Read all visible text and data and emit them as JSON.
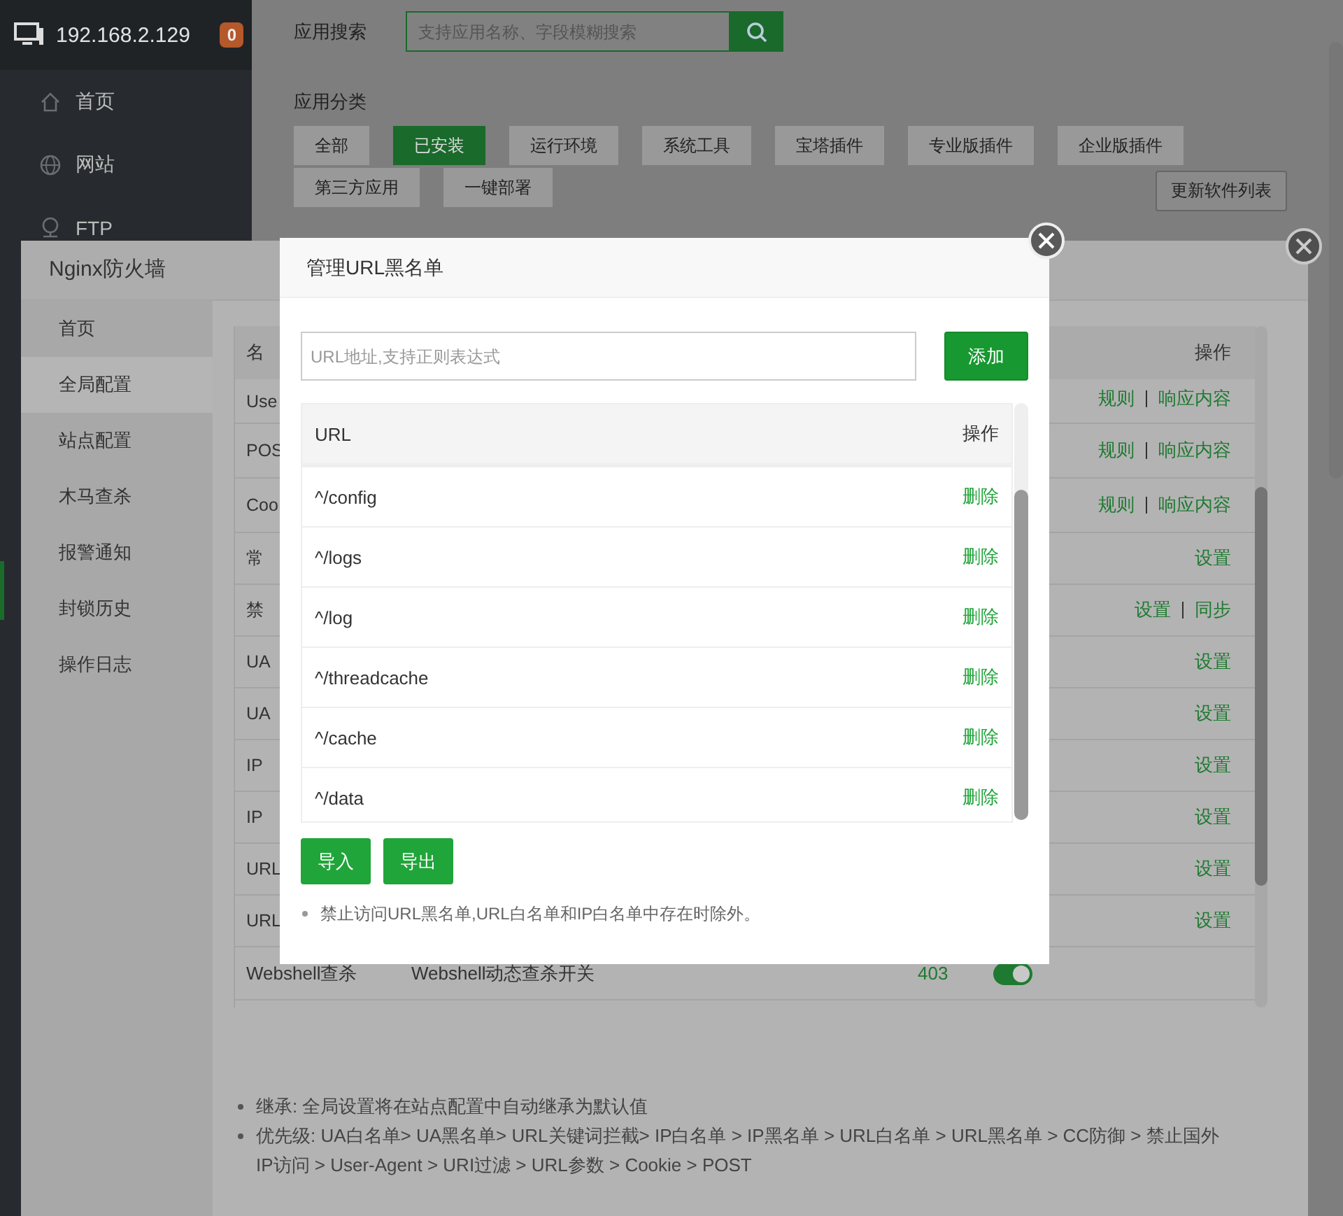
{
  "app": {
    "host": "192.168.2.129",
    "badge": "0",
    "nav": [
      {
        "label": "首页"
      },
      {
        "label": "网站"
      },
      {
        "label": "FTP"
      }
    ]
  },
  "store": {
    "search_label": "应用搜索",
    "search_placeholder": "支持应用名称、字段模糊搜索",
    "category_label": "应用分类",
    "categories": [
      {
        "label": "全部",
        "selected": false
      },
      {
        "label": "已安装",
        "selected": true
      },
      {
        "label": "运行环境",
        "selected": false
      },
      {
        "label": "系统工具",
        "selected": false
      },
      {
        "label": "宝塔插件",
        "selected": false
      },
      {
        "label": "专业版插件",
        "selected": false
      },
      {
        "label": "企业版插件",
        "selected": false
      },
      {
        "label": "第三方应用",
        "selected": false
      },
      {
        "label": "一键部署",
        "selected": false
      }
    ],
    "refresh_button": "更新软件列表"
  },
  "firewall": {
    "title": "Nginx防火墙",
    "nav": [
      {
        "label": "首页",
        "selected": false
      },
      {
        "label": "全局配置",
        "selected": true
      },
      {
        "label": "站点配置",
        "selected": false
      },
      {
        "label": "木马查杀",
        "selected": false
      },
      {
        "label": "报警通知",
        "selected": false
      },
      {
        "label": "封锁历史",
        "selected": false
      },
      {
        "label": "操作日志",
        "selected": false
      }
    ],
    "table": {
      "columns": [
        "名",
        "操作"
      ],
      "rows": [
        {
          "name": "Use",
          "actions": [
            "规则",
            "响应内容"
          ]
        },
        {
          "name": "POS",
          "actions": [
            "规则",
            "响应内容"
          ]
        },
        {
          "name": "Coo",
          "actions": [
            "规则",
            "响应内容"
          ]
        },
        {
          "name": "常",
          "actions": [
            "设置"
          ]
        },
        {
          "name": "禁",
          "actions": [
            "设置",
            "同步"
          ]
        },
        {
          "name": "UA",
          "actions": [
            "设置"
          ]
        },
        {
          "name": "UA",
          "actions": [
            "设置"
          ]
        },
        {
          "name": "IP",
          "actions": [
            "设置"
          ]
        },
        {
          "name": "IP",
          "actions": [
            "设置"
          ]
        },
        {
          "name": "URL",
          "actions": [
            "设置"
          ]
        },
        {
          "name": "URL",
          "actions": [
            "设置"
          ]
        }
      ],
      "last_row": {
        "name": "Webshell查杀",
        "description": "Webshell动态查杀开关",
        "code": "403",
        "on": true
      }
    },
    "notes": [
      "继承: 全局设置将在站点配置中自动继承为默认值",
      "优先级: UA白名单> UA黑名单> URL关键词拦截> IP白名单 > IP黑名单 > URL白名单 > URL黑名单 > CC防御 > 禁止国外IP访问 > User-Agent > URI过滤 > URL参数 > Cookie > POST"
    ]
  },
  "modal": {
    "title": "管理URL黑名单",
    "placeholder": "URL地址,支持正则表达式",
    "add_button": "添加",
    "columns": [
      "URL",
      "操作"
    ],
    "rows": [
      {
        "url": "^/config",
        "action": "删除"
      },
      {
        "url": "^/logs",
        "action": "删除"
      },
      {
        "url": "^/log",
        "action": "删除"
      },
      {
        "url": "^/threadcache",
        "action": "删除"
      },
      {
        "url": "^/cache",
        "action": "删除"
      },
      {
        "url": "^/data",
        "action": "删除"
      }
    ],
    "buttons": [
      "导入",
      "导出"
    ],
    "note": "禁止访问URL黑名单,URL白名单和IP白名单中存在时除外。"
  }
}
